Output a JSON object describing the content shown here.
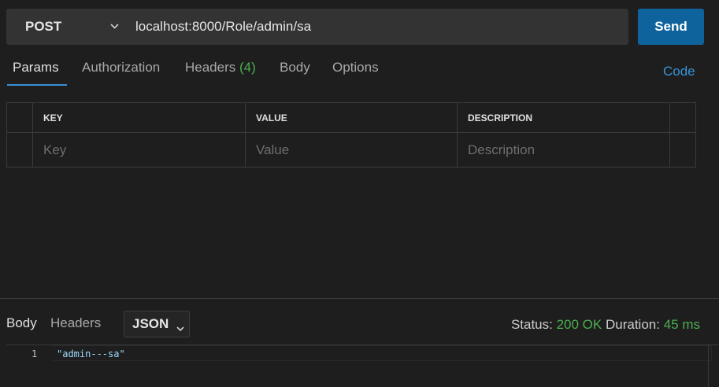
{
  "request": {
    "method": "POST",
    "url": "localhost:8000/Role/admin/sa",
    "send_label": "Send"
  },
  "tabs": [
    {
      "label": "Params"
    },
    {
      "label": "Authorization"
    },
    {
      "label": "Headers",
      "count": "(4)"
    },
    {
      "label": "Body"
    },
    {
      "label": "Options"
    }
  ],
  "code_label": "Code",
  "params_table": {
    "headers": [
      "KEY",
      "VALUE",
      "DESCRIPTION"
    ],
    "placeholders": [
      "Key",
      "Value",
      "Description"
    ]
  },
  "response": {
    "tabs": [
      "Body",
      "Headers"
    ],
    "format": "JSON",
    "status_label": "Status:",
    "status_value": "200 OK",
    "duration_label": "Duration:",
    "duration_value": "45 ms",
    "lines": [
      {
        "number": "1",
        "text": "\"admin---sa\""
      }
    ]
  },
  "colors": {
    "accent": "#0e639c",
    "success": "#4caf50",
    "link": "#3794d8"
  },
  "icons": {
    "method_dropdown": "chevron-down-icon",
    "format_dropdown": "chevron-down-icon"
  }
}
